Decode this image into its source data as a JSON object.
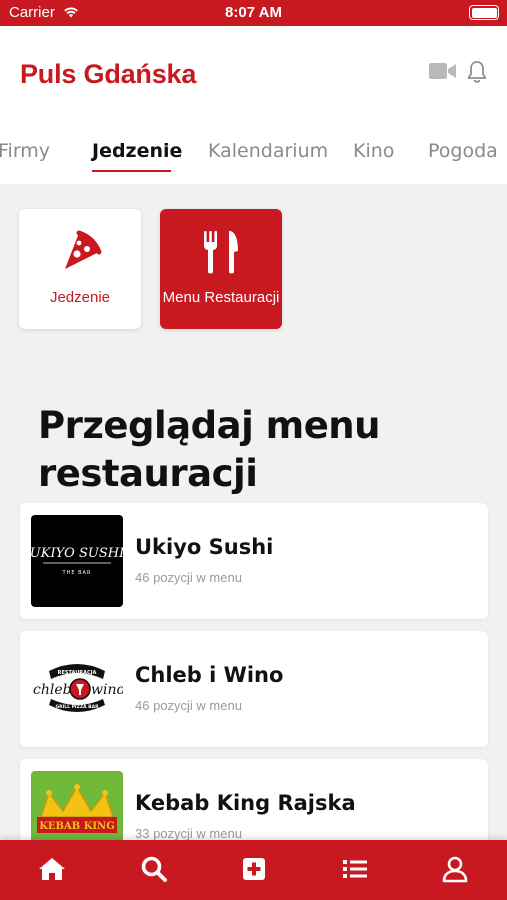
{
  "status_bar": {
    "carrier": "Carrier",
    "time": "8:07 AM"
  },
  "header": {
    "title": "Puls Gdańska",
    "icons": [
      "video-camera-icon",
      "bell-icon"
    ]
  },
  "tabs": [
    {
      "label": "Firmy",
      "active": false
    },
    {
      "label": "Jedzenie",
      "active": true
    },
    {
      "label": "Kalendarium",
      "active": false
    },
    {
      "label": "Kino",
      "active": false
    },
    {
      "label": "Pogoda",
      "active": false
    }
  ],
  "categories": [
    {
      "label": "Jedzenie",
      "icon": "pizza-slice-icon",
      "selected": false
    },
    {
      "label": "Menu Restauracji",
      "icon": "utensils-icon",
      "selected": true
    }
  ],
  "section": {
    "title_line1": "Przeglądaj menu",
    "title_line2": "restauracji"
  },
  "restaurants": [
    {
      "name": "Ukiyo Sushi",
      "count": "46 pozycji w menu",
      "logo_text": "UKIYO SUSHI",
      "logo_sub": "THE BAR"
    },
    {
      "name": "Chleb i Wino",
      "count": "46 pozycji w menu",
      "logo_text_left": "chleb",
      "logo_text_right": "wino",
      "logo_top": "RESTAURACJA",
      "logo_bottom": "GRILL PIZZA BAR"
    },
    {
      "name": "Kebab King Rajska",
      "count": "33 pozycji w menu",
      "logo_text": "KEBAB KING"
    }
  ],
  "tabbar": {
    "icons": [
      "home-icon",
      "search-icon",
      "add-icon",
      "list-icon",
      "profile-icon"
    ]
  },
  "colors": {
    "brand": "#c7191f",
    "background": "#f1f1f1"
  }
}
